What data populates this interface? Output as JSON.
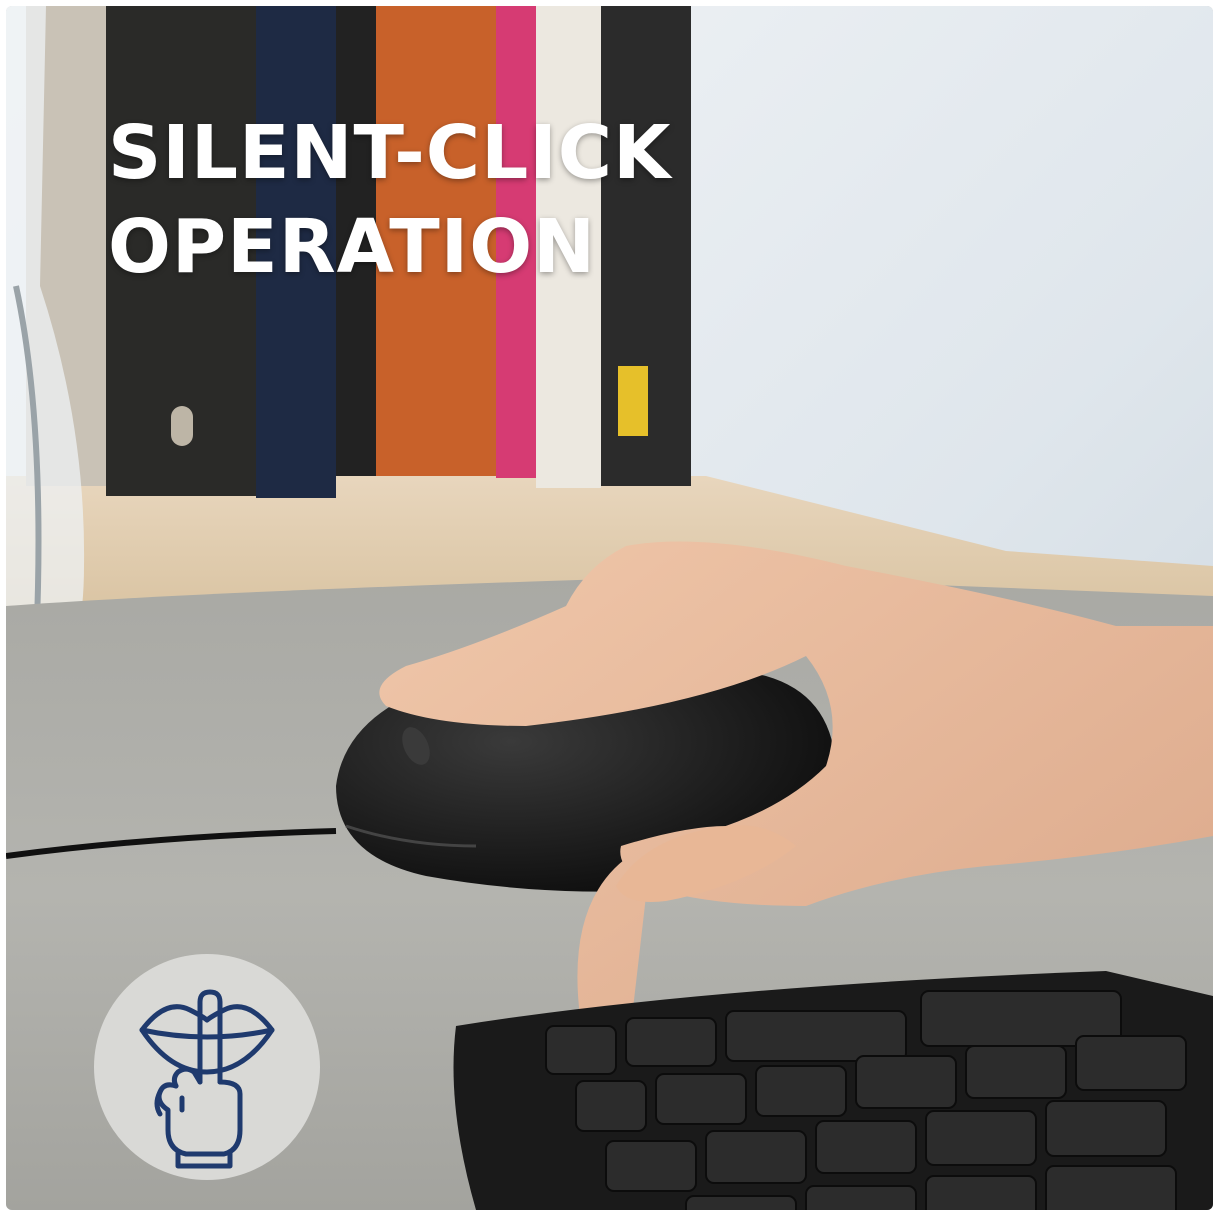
{
  "headline": {
    "line1": "SILENT-CLICK",
    "line2": "OPERATION"
  },
  "badge": {
    "icon": "silence-gesture-icon",
    "icon_color": "#1f3a6e",
    "background": "#d9d9d6"
  },
  "colors": {
    "headline_text": "#ffffff",
    "mouse": "#141414",
    "keyboard": "#1c1c1c",
    "desk_mat": "#b9b9b4"
  }
}
